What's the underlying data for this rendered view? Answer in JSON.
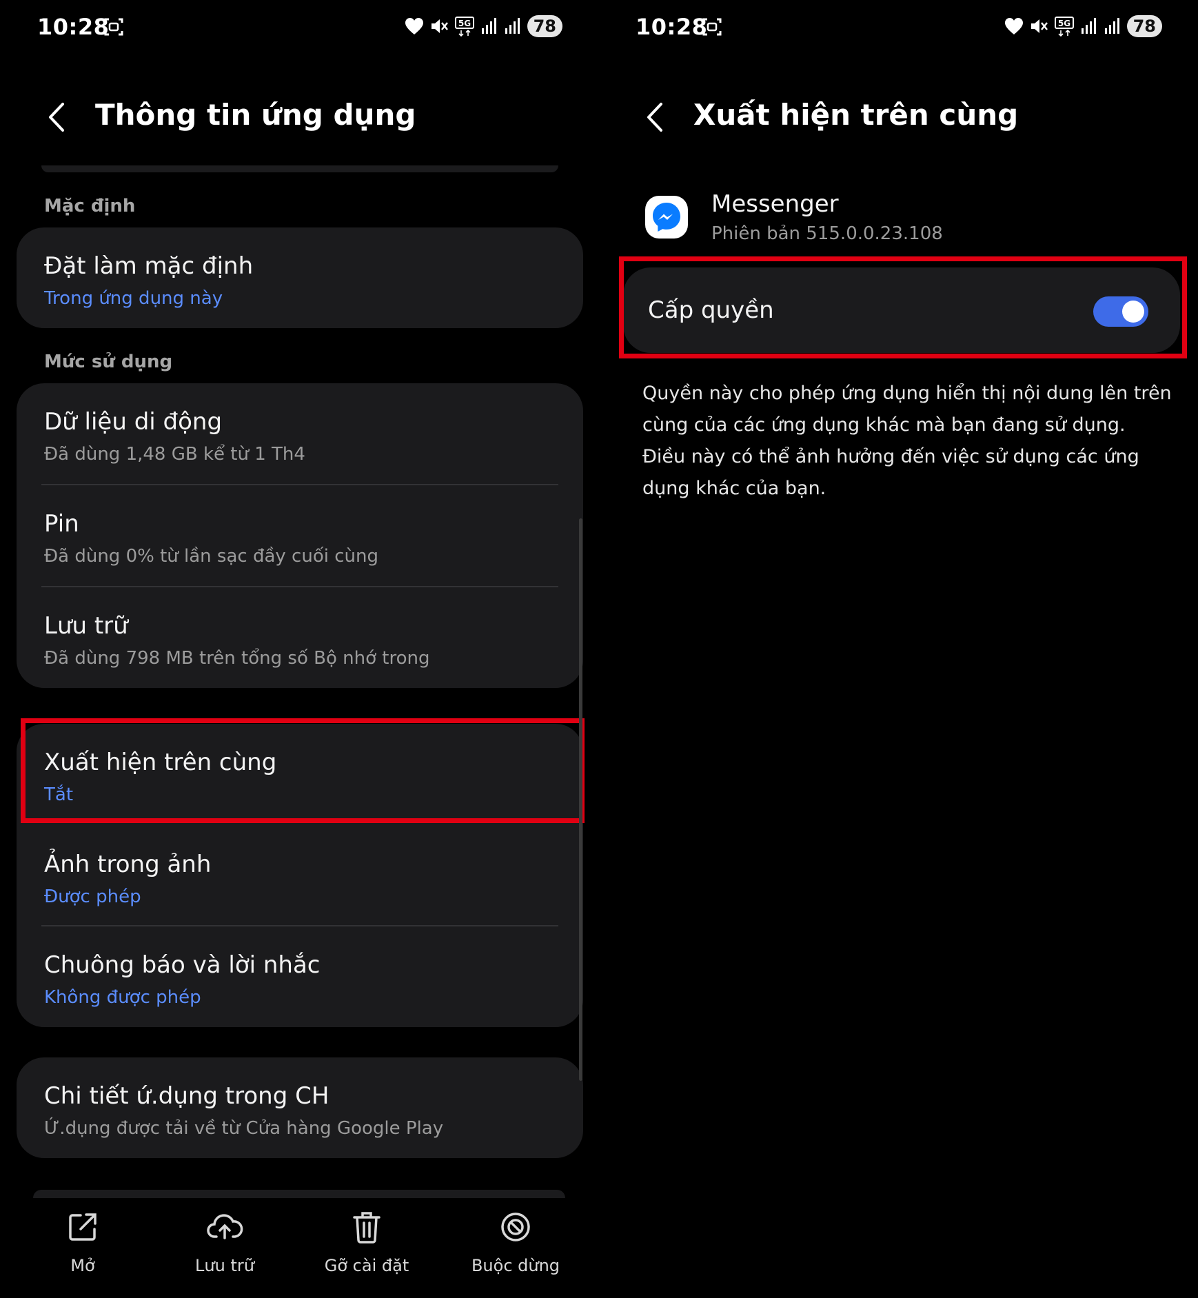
{
  "status_bar": {
    "time": "10:28",
    "network": "5G",
    "battery": "78"
  },
  "left": {
    "title": "Thông tin ứng dụng",
    "sections": {
      "default_label": "Mặc định",
      "usage_label": "Mức sử dụng"
    },
    "items": {
      "set_default": {
        "title": "Đặt làm mặc định",
        "sub": "Trong ứng dụng này"
      },
      "mobile_data": {
        "title": "Dữ liệu di động",
        "sub": "Đã dùng 1,48 GB kể từ 1 Th4"
      },
      "battery": {
        "title": "Pin",
        "sub": "Đã dùng 0% từ lần sạc đầy cuối cùng"
      },
      "storage": {
        "title": "Lưu trữ",
        "sub": "Đã dùng 798 MB trên tổng số Bộ nhớ trong"
      },
      "appear_on_top": {
        "title": "Xuất hiện trên cùng",
        "sub": "Tắt"
      },
      "pip": {
        "title": "Ảnh trong ảnh",
        "sub": "Được phép"
      },
      "alarms": {
        "title": "Chuông báo và lời nhắc",
        "sub": "Không được phép"
      },
      "store_details": {
        "title": "Chi tiết ứ.dụng trong CH",
        "sub": "Ứ.dụng được tải về từ Cửa hàng Google Play"
      }
    },
    "bottom_bar": {
      "open": "Mở",
      "archive": "Lưu trữ",
      "uninstall": "Gỡ cài đặt",
      "force_stop": "Buộc dừng"
    }
  },
  "right": {
    "title": "Xuất hiện trên cùng",
    "app_name": "Messenger",
    "app_version": "Phiên bản 515.0.0.23.108",
    "permission_label": "Cấp quyền",
    "permission_enabled": true,
    "description": "Quyền này cho phép ứng dụng hiển thị nội dung lên trên cùng của các ứng dụng khác mà bạn đang sử dụng. Điều này có thể ảnh hưởng đến việc sử dụng các ứng dụng khác của bạn."
  },
  "colors": {
    "accent_blue": "#5b8dff",
    "toggle_on": "#3e6be8",
    "highlight_red": "#e10012",
    "card_bg": "#1b1b1d"
  }
}
